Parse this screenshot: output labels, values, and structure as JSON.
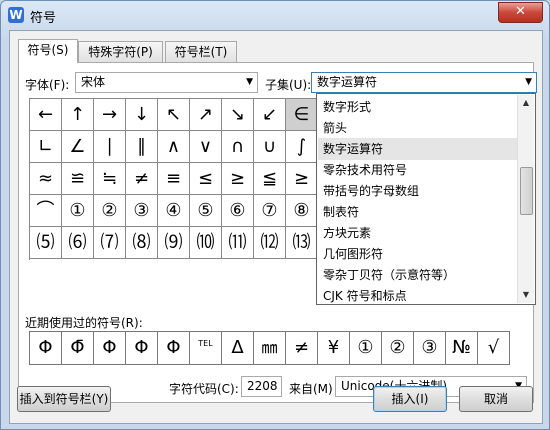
{
  "window": {
    "title": "符号",
    "close": "✕"
  },
  "tabs": [
    {
      "label": "符号(S)",
      "active": true
    },
    {
      "label": "特殊字符(P)",
      "active": false
    },
    {
      "label": "符号栏(T)",
      "active": false
    }
  ],
  "font": {
    "label": "字体(F):",
    "value": "宋体"
  },
  "subset": {
    "label": "子集(U):",
    "value": "数字运算符"
  },
  "subset_options": [
    {
      "label": "数字形式",
      "highlighted": false
    },
    {
      "label": "箭头",
      "highlighted": false
    },
    {
      "label": "数字运算符",
      "highlighted": true
    },
    {
      "label": "零杂技术用符号",
      "highlighted": false
    },
    {
      "label": "带括号的字母数组",
      "highlighted": false
    },
    {
      "label": "制表符",
      "highlighted": false
    },
    {
      "label": "方块元素",
      "highlighted": false
    },
    {
      "label": "几何图形符",
      "highlighted": false
    },
    {
      "label": "零杂丁贝符（示意符等）",
      "highlighted": false
    },
    {
      "label": "CJK 符号和标点",
      "highlighted": false
    }
  ],
  "symbol_grid": [
    [
      "←",
      "↑",
      "→",
      "↓",
      "↖",
      "↗",
      "↘",
      "↙",
      "∈"
    ],
    [
      "∟",
      "∠",
      "∣",
      "∥",
      "∧",
      "∨",
      "∩",
      "∪",
      "∫"
    ],
    [
      "≈",
      "≌",
      "≒",
      "≠",
      "≡",
      "≤",
      "≥",
      "≦",
      "≥"
    ],
    [
      "⌒",
      "①",
      "②",
      "③",
      "④",
      "⑤",
      "⑥",
      "⑦",
      "⑧"
    ],
    [
      "⑸",
      "⑹",
      "⑺",
      "⑻",
      "⑼",
      "⑽",
      "⑾",
      "⑿",
      "⒀"
    ]
  ],
  "selected_symbol": "∈",
  "recent": {
    "label": "近期使用过的符号(R):",
    "symbols": [
      "Φ",
      "Φ̄",
      "Φ",
      "Φ",
      "Φ",
      "TEL",
      "Δ",
      "㎜",
      "≠",
      "¥",
      "①",
      "②",
      "③",
      "№",
      "√"
    ]
  },
  "char_code": {
    "label": "字符代码(C):",
    "value": "2208"
  },
  "from": {
    "label": "来自(M)",
    "value": "Unicode(十六进制)"
  },
  "buttons": {
    "insert_to_bar": "插入到符号栏(Y)",
    "insert": "插入(I)",
    "cancel": "取消"
  }
}
